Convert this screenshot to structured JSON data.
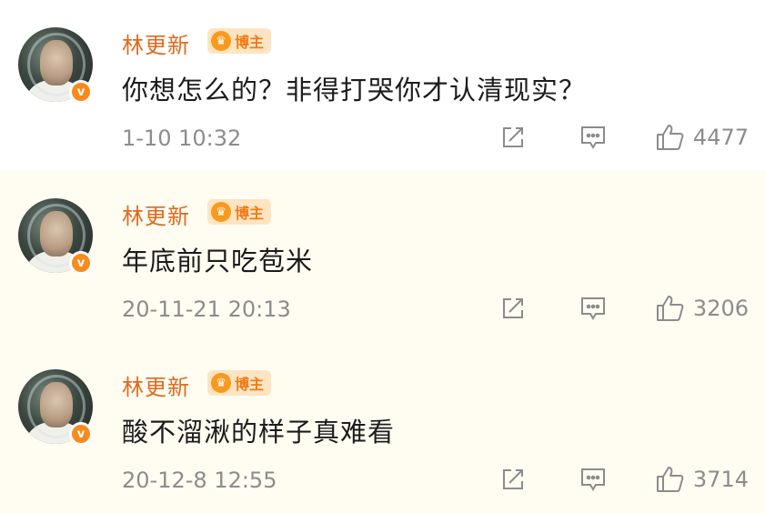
{
  "comments": [
    {
      "username": "林更新",
      "badge": "博主",
      "content": "你想怎么的？非得打哭你才认清现实？",
      "timestamp": "1-10 10:32",
      "likes": "4477"
    },
    {
      "username": "林更新",
      "badge": "博主",
      "content": "年底前只吃苞米",
      "timestamp": "20-11-21 20:13",
      "likes": "3206"
    },
    {
      "username": "林更新",
      "badge": "博主",
      "content": "酸不溜湫的样子真难看",
      "timestamp": "20-12-8 12:55",
      "likes": "3714"
    }
  ],
  "verified_mark": "v",
  "icons": {
    "share": "share-icon",
    "reply": "comment-icon",
    "like": "thumbs-up-icon",
    "badge_crown": "crown-icon"
  },
  "colors": {
    "username": "#e06a1e",
    "badge_bg": "#ffe4c2",
    "verified": "#f78b1e",
    "highlight_bg": "#fffdf2",
    "meta": "#8c8c8c"
  }
}
